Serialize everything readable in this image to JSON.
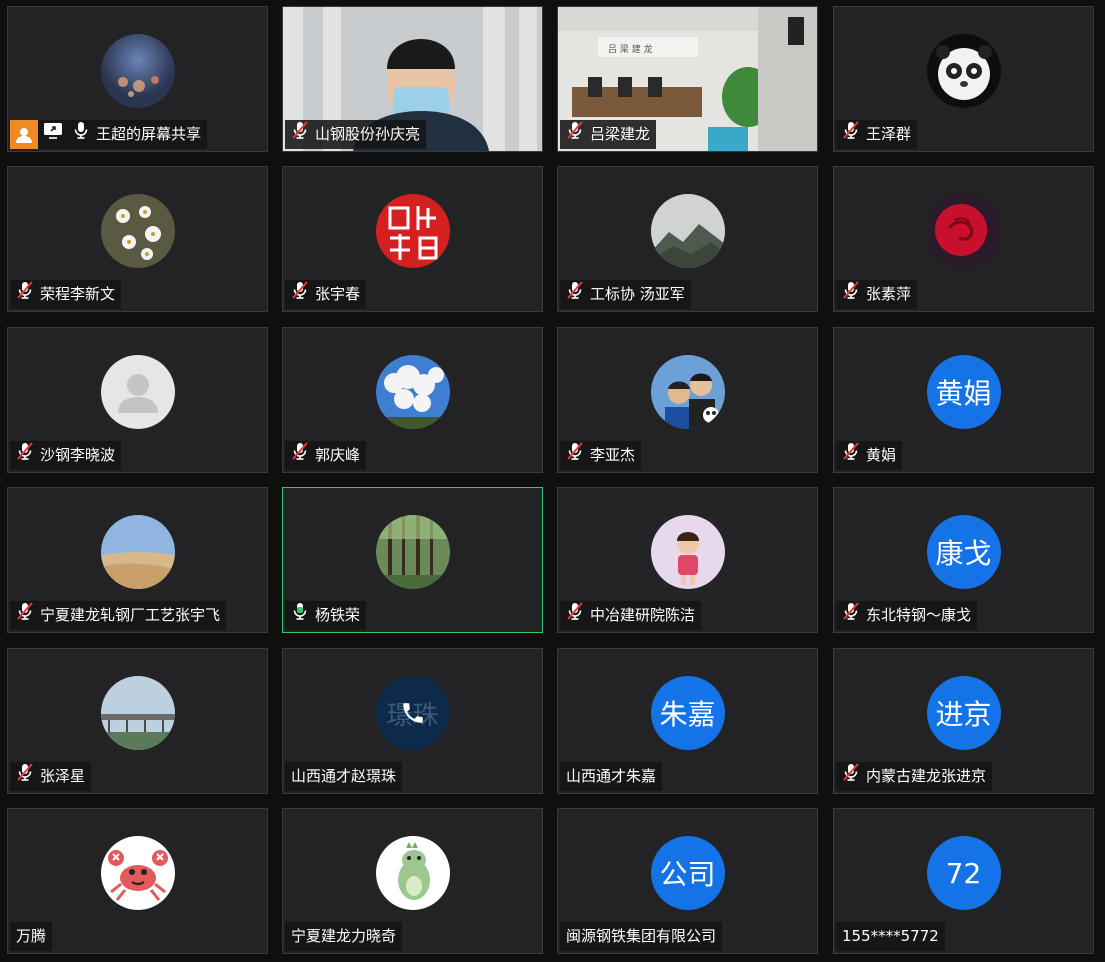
{
  "participants": [
    {
      "name": "王超的屏幕共享",
      "mic": "on",
      "avatar": "photo",
      "photo": "bokeh",
      "badges": [
        "user-icon",
        "screen-share-icon"
      ]
    },
    {
      "name": "山钢股份孙庆亮",
      "mic": "muted",
      "avatar": "video",
      "photo": "man-mask"
    },
    {
      "name": "吕梁建龙",
      "mic": "muted",
      "avatar": "video",
      "photo": "meeting-room"
    },
    {
      "name": "王泽群",
      "mic": "muted",
      "avatar": "photo",
      "photo": "panda"
    },
    {
      "name": "荣程李新文",
      "mic": "muted",
      "avatar": "photo",
      "photo": "flowers"
    },
    {
      "name": "张宇春",
      "mic": "muted",
      "avatar": "photo",
      "photo": "seal"
    },
    {
      "name": "工标协 汤亚军",
      "mic": "muted",
      "avatar": "photo",
      "photo": "mountain"
    },
    {
      "name": "张素萍",
      "mic": "muted",
      "avatar": "photo",
      "photo": "rose"
    },
    {
      "name": "沙钢李晓波",
      "mic": "muted",
      "avatar": "default",
      "photo": ""
    },
    {
      "name": "郭庆峰",
      "mic": "muted",
      "avatar": "photo",
      "photo": "sky"
    },
    {
      "name": "李亚杰",
      "mic": "muted",
      "avatar": "photo",
      "photo": "selfie"
    },
    {
      "name": "黄娟",
      "mic": "muted",
      "avatar": "text",
      "text": "黄娟"
    },
    {
      "name": "宁夏建龙轧钢厂工艺张宇飞",
      "mic": "muted",
      "avatar": "photo",
      "photo": "desert"
    },
    {
      "name": "杨铁荣",
      "mic": "active",
      "avatar": "photo",
      "photo": "forest"
    },
    {
      "name": "中冶建研院陈洁",
      "mic": "muted",
      "avatar": "photo",
      "photo": "child"
    },
    {
      "name": "东北特钢～康戈",
      "mic": "muted",
      "avatar": "text",
      "text": "康戈"
    },
    {
      "name": "张泽星",
      "mic": "muted",
      "avatar": "photo",
      "photo": "bridge"
    },
    {
      "name": "山西通才赵璟珠",
      "mic": "none",
      "avatar": "phone",
      "text": "璟珠"
    },
    {
      "name": "山西通才朱嘉",
      "mic": "none",
      "avatar": "text",
      "text": "朱嘉"
    },
    {
      "name": "内蒙古建龙张进京",
      "mic": "muted",
      "avatar": "text",
      "text": "进京"
    },
    {
      "name": "万腾",
      "mic": "none",
      "avatar": "photo",
      "photo": "crab"
    },
    {
      "name": "宁夏建龙力晓奇",
      "mic": "none",
      "avatar": "photo",
      "photo": "dino"
    },
    {
      "name": "闽源钢铁集团有限公司",
      "mic": "none",
      "avatar": "text",
      "text": "公司"
    },
    {
      "name": "155****5772",
      "mic": "none",
      "avatar": "text",
      "text": "72"
    }
  ],
  "colors": {
    "tile_bg": "#232325",
    "tile_border": "#3a3a3d",
    "speaking_border": "#2ecc71",
    "avatar_blue": "#1473e6",
    "muted_red": "#e5383b",
    "share_orange": "#f08a24"
  }
}
